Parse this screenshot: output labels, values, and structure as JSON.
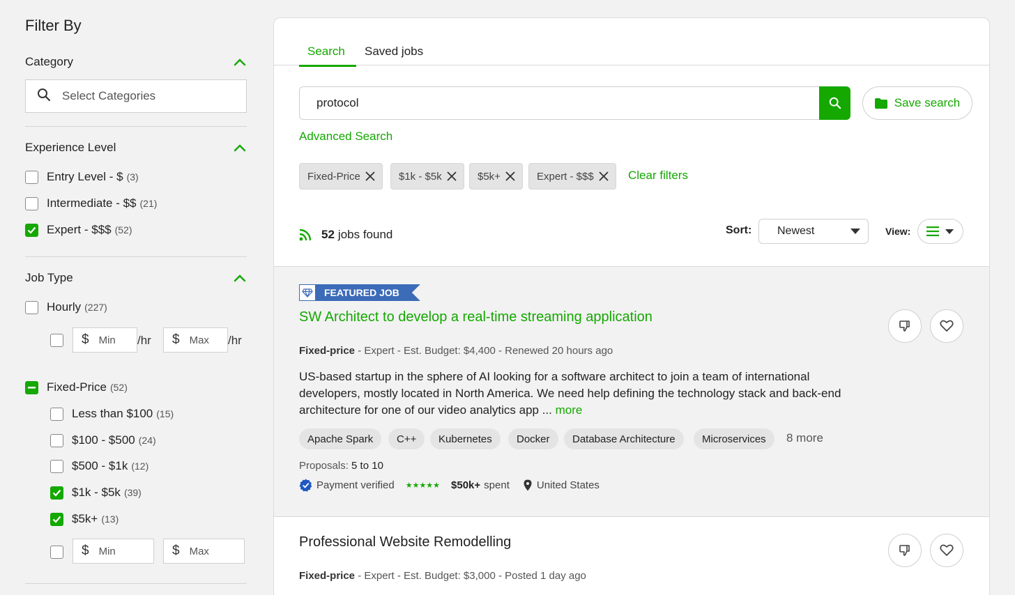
{
  "sidebar": {
    "title": "Filter By",
    "category": {
      "label": "Category",
      "placeholder": "Select Categories"
    },
    "experience": {
      "label": "Experience Level",
      "options": [
        {
          "label": "Entry Level - $",
          "count": "(3)",
          "checked": false
        },
        {
          "label": "Intermediate - $$",
          "count": "(21)",
          "checked": false
        },
        {
          "label": "Expert - $$$",
          "count": "(52)",
          "checked": true
        }
      ]
    },
    "job_type": {
      "label": "Job Type",
      "hourly": {
        "label": "Hourly",
        "count": "(227)",
        "min_placeholder": "Min",
        "max_placeholder": "Max",
        "per_hr": "/hr",
        "currency": "$"
      },
      "fixed": {
        "label": "Fixed-Price",
        "count": "(52)",
        "options": [
          {
            "label": "Less than $100",
            "count": "(15)",
            "checked": false
          },
          {
            "label": "$100 - $500",
            "count": "(24)",
            "checked": false
          },
          {
            "label": "$500 - $1k",
            "count": "(12)",
            "checked": false
          },
          {
            "label": "$1k - $5k",
            "count": "(39)",
            "checked": true
          },
          {
            "label": "$5k+",
            "count": "(13)",
            "checked": true
          }
        ],
        "min_placeholder": "Min",
        "max_placeholder": "Max",
        "currency": "$"
      }
    }
  },
  "tabs": {
    "search": "Search",
    "saved": "Saved jobs"
  },
  "search": {
    "query": "protocol",
    "save_label": "Save search",
    "advanced": "Advanced Search"
  },
  "filters": {
    "chips": [
      "Fixed-Price",
      "$1k - $5k",
      "$5k+",
      "Expert - $$$"
    ],
    "clear_label": "Clear filters"
  },
  "results": {
    "count": "52",
    "found_label": "jobs found",
    "sort_label": "Sort:",
    "sort_value": "Newest",
    "view_label": "View:"
  },
  "jobs": [
    {
      "badge": "FEATURED JOB",
      "title": "SW Architect to develop a real-time streaming application",
      "type": "Fixed-price",
      "meta_rest": " - Expert - Est. Budget: $4,400 - Renewed 20 hours ago",
      "description": "US-based startup in the sphere of AI looking for a software architect to join a team of international developers, mostly located in North America. We need help defining the technology stack and back-end architecture for one of our video analytics app ...",
      "more_label": "more",
      "skills": [
        "Apache Spark",
        "C++",
        "Kubernetes",
        "Docker",
        "Database Architecture",
        "Microservices"
      ],
      "more_skills": "8 more",
      "proposals_label": "Proposals:",
      "proposals_value": "5 to 10",
      "payment": "Payment verified",
      "rating": 5,
      "spent_value": "$50k+",
      "spent_label": "spent",
      "location": "United States"
    },
    {
      "title": "Professional Website Remodelling",
      "type": "Fixed-price",
      "meta_rest": " - Expert - Est. Budget: $3,000 - Posted 1 day ago"
    }
  ],
  "colors": {
    "accent": "#14a800",
    "featured": "#3c6bb7",
    "verified": "#1f57c3"
  }
}
